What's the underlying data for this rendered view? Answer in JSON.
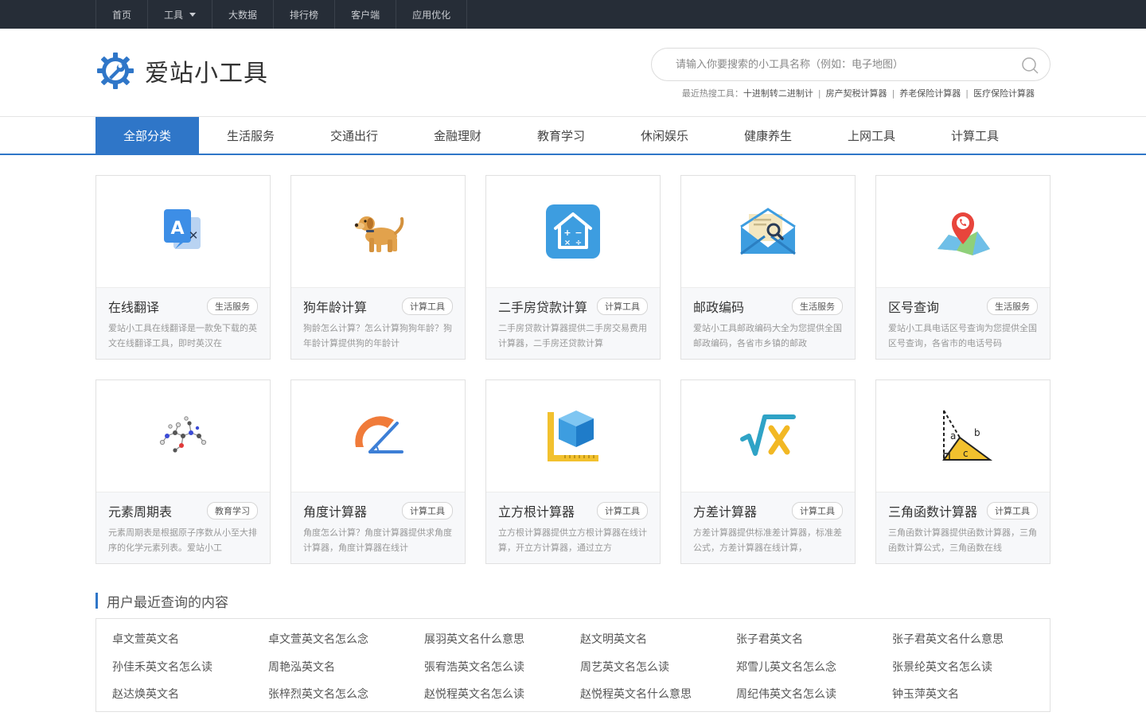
{
  "topnav": [
    {
      "label": "首页"
    },
    {
      "label": "工具",
      "dropdown": true
    },
    {
      "label": "大数据"
    },
    {
      "label": "排行榜"
    },
    {
      "label": "客户端"
    },
    {
      "label": "应用优化"
    }
  ],
  "logo": {
    "text": "爱站小工具"
  },
  "search": {
    "placeholder": "请输入你要搜索的小工具名称（例如：电子地图）",
    "value": ""
  },
  "hot": {
    "label": "最近热搜工具：",
    "items": [
      "十进制转二进制计",
      "房产契税计算器",
      "养老保险计算器",
      "医疗保险计算器"
    ]
  },
  "categories": [
    "全部分类",
    "生活服务",
    "交通出行",
    "金融理财",
    "教育学习",
    "休闲娱乐",
    "健康养生",
    "上网工具",
    "计算工具"
  ],
  "tools": [
    {
      "title": "在线翻译",
      "tag": "生活服务",
      "desc": "爱站小工具在线翻译是一款免下载的英文在线翻译工具，即时英汉在",
      "icon": "translate-icon"
    },
    {
      "title": "狗年龄计算",
      "tag": "计算工具",
      "desc": "狗龄怎么计算？怎么计算狗狗年龄？狗年龄计算提供狗的年龄计",
      "icon": "dog-icon"
    },
    {
      "title": "二手房贷款计算",
      "tag": "计算工具",
      "desc": "二手房贷款计算器提供二手房交易费用计算器，二手房还贷款计算",
      "icon": "house-calculator-icon"
    },
    {
      "title": "邮政编码",
      "tag": "生活服务",
      "desc": "爱站小工具邮政编码大全为您提供全国邮政编码，各省市乡镇的邮政",
      "icon": "envelope-search-icon"
    },
    {
      "title": "区号查询",
      "tag": "生活服务",
      "desc": "爱站小工具电话区号查询为您提供全国区号查询，各省市的电话号码",
      "icon": "map-pin-phone-icon"
    },
    {
      "title": "元素周期表",
      "tag": "教育学习",
      "desc": "元素周期表是根据原子序数从小至大排序的化学元素列表。爱站小工",
      "icon": "molecule-icon"
    },
    {
      "title": "角度计算器",
      "tag": "计算工具",
      "desc": "角度怎么计算？角度计算器提供求角度计算器，角度计算器在线计",
      "icon": "protractor-icon"
    },
    {
      "title": "立方根计算器",
      "tag": "计算工具",
      "desc": "立方根计算器提供立方根计算器在线计算，开立方计算器，通过立方",
      "icon": "cube-ruler-icon"
    },
    {
      "title": "方差计算器",
      "tag": "计算工具",
      "desc": "方差计算器提供标准差计算器，标准差公式，方差计算器在线计算，",
      "icon": "sqrt-x-icon"
    },
    {
      "title": "三角函数计算器",
      "tag": "计算工具",
      "desc": "三角函数计算器提供函数计算器，三角函数计算公式，三角函数在线",
      "icon": "triangle-abc-icon"
    }
  ],
  "recent": {
    "title": "用户最近查询的内容",
    "items": [
      "卓文萱英文名",
      "卓文萱英文名怎么念",
      "展羽英文名什么意思",
      "赵文明英文名",
      "张子君英文名",
      "张子君英文名什么意思",
      "孙佳禾英文名怎么读",
      "周艳泓英文名",
      "張宥浩英文名怎么读",
      "周艺英文名怎么读",
      "郑雪儿英文名怎么念",
      "张景纶英文名怎么读",
      "赵达焕英文名",
      "张梓烈英文名怎么念",
      "赵悦程英文名怎么读",
      "赵悦程英文名什么意思",
      "周纪伟英文名怎么读",
      "钟玉萍英文名"
    ]
  },
  "colors": {
    "accent": "#2f76c8",
    "topbar": "#262d37"
  }
}
